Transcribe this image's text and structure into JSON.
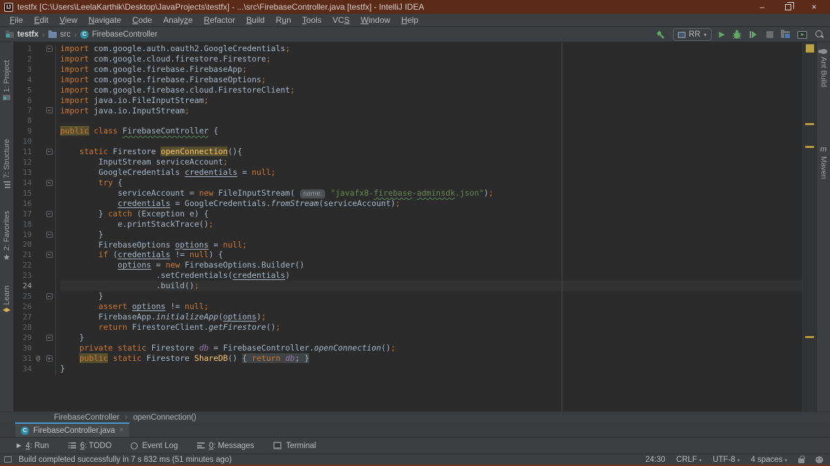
{
  "window": {
    "title": "testfx [C:\\Users\\LeelaKarthik\\Desktop\\JavaProjects\\testfx] - ...\\src\\FirebaseController.java [testfx] - IntelliJ IDEA",
    "minimize": "–",
    "close": "×"
  },
  "menu": {
    "items": [
      {
        "label": "File",
        "u": 0
      },
      {
        "label": "Edit",
        "u": 0
      },
      {
        "label": "View",
        "u": 0
      },
      {
        "label": "Navigate",
        "u": 0
      },
      {
        "label": "Code",
        "u": 0
      },
      {
        "label": "Analyze",
        "u": 5
      },
      {
        "label": "Refactor",
        "u": 0
      },
      {
        "label": "Build",
        "u": 0
      },
      {
        "label": "Run",
        "u": 1
      },
      {
        "label": "Tools",
        "u": 0
      },
      {
        "label": "VCS",
        "u": 2
      },
      {
        "label": "Window",
        "u": 0
      },
      {
        "label": "Help",
        "u": 0
      }
    ]
  },
  "navbar": {
    "crumbs": [
      {
        "label": "testfx",
        "icon": "project-folder-icon",
        "bold": true
      },
      {
        "label": "src",
        "icon": "folder-icon"
      },
      {
        "label": "FirebaseController",
        "icon": "class-icon"
      }
    ],
    "run_config": "RR",
    "dropdown_arrow": "▾"
  },
  "left_stripe": {
    "items": [
      {
        "label": "1: Project"
      },
      {
        "label": "7: Structure"
      },
      {
        "label": "2: Favorites"
      },
      {
        "label": "Learn"
      }
    ]
  },
  "right_stripe": {
    "items": [
      {
        "label": "Ant Build"
      },
      {
        "label": "Maven"
      }
    ]
  },
  "editor": {
    "current_line": 24,
    "stripe_marks": [
      117,
      150,
      425
    ],
    "lines": [
      {
        "n": 1,
        "fold": "m",
        "seg": [
          {
            "t": "import",
            "s": "kw"
          },
          {
            "t": " com.google.auth.oauth2.GoogleCredentials",
            "s": "tx"
          },
          {
            "t": ";",
            "s": "kw"
          }
        ]
      },
      {
        "n": 2,
        "seg": [
          {
            "t": "import",
            "s": "kw"
          },
          {
            "t": " com.google.cloud.firestore.Firestore",
            "s": "tx"
          },
          {
            "t": ";",
            "s": "kw"
          }
        ]
      },
      {
        "n": 3,
        "seg": [
          {
            "t": "import",
            "s": "kw"
          },
          {
            "t": " com.google.firebase.FirebaseApp",
            "s": "tx"
          },
          {
            "t": ";",
            "s": "kw"
          }
        ]
      },
      {
        "n": 4,
        "seg": [
          {
            "t": "import",
            "s": "kw"
          },
          {
            "t": " com.google.firebase.FirebaseOptions",
            "s": "tx"
          },
          {
            "t": ";",
            "s": "kw"
          }
        ]
      },
      {
        "n": 5,
        "seg": [
          {
            "t": "import",
            "s": "kw"
          },
          {
            "t": " com.google.firebase.cloud.FirestoreClient",
            "s": "tx"
          },
          {
            "t": ";",
            "s": "kw"
          }
        ]
      },
      {
        "n": 6,
        "seg": [
          {
            "t": "import",
            "s": "kw"
          },
          {
            "t": " java.io.FileInputStream",
            "s": "tx"
          },
          {
            "t": ";",
            "s": "kw"
          }
        ]
      },
      {
        "n": 7,
        "fold": "m",
        "seg": [
          {
            "t": "import",
            "s": "kw"
          },
          {
            "t": " java.io.InputStream",
            "s": "tx"
          },
          {
            "t": ";",
            "s": "kw"
          }
        ]
      },
      {
        "n": 8,
        "seg": []
      },
      {
        "n": 9,
        "seg": [
          {
            "t": "public",
            "s": "kw hl"
          },
          {
            "t": " ",
            "s": "tx"
          },
          {
            "t": "class",
            "s": "kw"
          },
          {
            "t": " ",
            "s": "tx"
          },
          {
            "t": "FirebaseController",
            "s": "tx wv"
          },
          {
            "t": " {",
            "s": "tx"
          }
        ]
      },
      {
        "n": 10,
        "seg": []
      },
      {
        "n": 11,
        "fold": "m",
        "seg": [
          {
            "t": "    ",
            "s": "tx"
          },
          {
            "t": "static",
            "s": "kw"
          },
          {
            "t": " Firestore ",
            "s": "tx"
          },
          {
            "t": "openConnection",
            "s": "md hl"
          },
          {
            "t": "(){",
            "s": "tx"
          }
        ]
      },
      {
        "n": 12,
        "seg": [
          {
            "t": "        InputStream serviceAccount",
            "s": "tx"
          },
          {
            "t": ";",
            "s": "kw"
          }
        ]
      },
      {
        "n": 13,
        "seg": [
          {
            "t": "        GoogleCredentials ",
            "s": "tx"
          },
          {
            "t": "credentials",
            "s": "tx ul"
          },
          {
            "t": " = ",
            "s": "tx"
          },
          {
            "t": "null",
            "s": "kw"
          },
          {
            "t": ";",
            "s": "kw"
          }
        ]
      },
      {
        "n": 14,
        "fold": "m",
        "seg": [
          {
            "t": "        ",
            "s": "tx"
          },
          {
            "t": "try",
            "s": "kw"
          },
          {
            "t": " {",
            "s": "tx"
          }
        ]
      },
      {
        "n": 15,
        "seg": [
          {
            "t": "            serviceAccount = ",
            "s": "tx"
          },
          {
            "t": "new",
            "s": "kw"
          },
          {
            "t": " FileInputStream( ",
            "s": "tx"
          },
          {
            "t": "name:",
            "s": "hn"
          },
          {
            "t": " ",
            "s": "tx"
          },
          {
            "t": "\"javafx8-",
            "s": "st"
          },
          {
            "t": "firebase",
            "s": "st wv"
          },
          {
            "t": "-",
            "s": "st"
          },
          {
            "t": "adminsdk",
            "s": "st wv"
          },
          {
            "t": ".json\"",
            "s": "st"
          },
          {
            "t": ")",
            "s": "tx"
          },
          {
            "t": ";",
            "s": "kw"
          }
        ]
      },
      {
        "n": 16,
        "seg": [
          {
            "t": "            ",
            "s": "tx"
          },
          {
            "t": "credentials",
            "s": "tx ul"
          },
          {
            "t": " = GoogleCredentials.",
            "s": "tx"
          },
          {
            "t": "fromStream",
            "s": "tx it"
          },
          {
            "t": "(serviceAccount)",
            "s": "tx"
          },
          {
            "t": ";",
            "s": "kw"
          }
        ]
      },
      {
        "n": 17,
        "fold": "m",
        "seg": [
          {
            "t": "        } ",
            "s": "tx"
          },
          {
            "t": "catch",
            "s": "kw"
          },
          {
            "t": " (Exception e) {",
            "s": "tx"
          }
        ]
      },
      {
        "n": 18,
        "seg": [
          {
            "t": "            e.printStackTrace()",
            "s": "tx"
          },
          {
            "t": ";",
            "s": "kw"
          }
        ]
      },
      {
        "n": 19,
        "fold": "m",
        "seg": [
          {
            "t": "        }",
            "s": "tx"
          }
        ]
      },
      {
        "n": 20,
        "seg": [
          {
            "t": "        FirebaseOptions ",
            "s": "tx"
          },
          {
            "t": "options",
            "s": "tx ul"
          },
          {
            "t": " = ",
            "s": "tx"
          },
          {
            "t": "null",
            "s": "kw"
          },
          {
            "t": ";",
            "s": "kw"
          }
        ]
      },
      {
        "n": 21,
        "fold": "m",
        "seg": [
          {
            "t": "        ",
            "s": "tx"
          },
          {
            "t": "if",
            "s": "kw"
          },
          {
            "t": " (",
            "s": "tx"
          },
          {
            "t": "credentials",
            "s": "tx ul"
          },
          {
            "t": " != ",
            "s": "tx"
          },
          {
            "t": "null",
            "s": "kw"
          },
          {
            "t": ") {",
            "s": "tx"
          }
        ]
      },
      {
        "n": 22,
        "seg": [
          {
            "t": "            ",
            "s": "tx"
          },
          {
            "t": "options",
            "s": "tx ul"
          },
          {
            "t": " = ",
            "s": "tx"
          },
          {
            "t": "new",
            "s": "kw"
          },
          {
            "t": " FirebaseOptions.Builder()",
            "s": "tx"
          }
        ]
      },
      {
        "n": 23,
        "seg": [
          {
            "t": "                    .setCredentials(",
            "s": "tx"
          },
          {
            "t": "credentials",
            "s": "tx ul"
          },
          {
            "t": ")",
            "s": "tx"
          }
        ]
      },
      {
        "n": 24,
        "seg": [
          {
            "t": "                    .build()",
            "s": "tx"
          },
          {
            "t": ";",
            "s": "kw"
          }
        ]
      },
      {
        "n": 25,
        "fold": "m",
        "seg": [
          {
            "t": "        }",
            "s": "tx"
          }
        ]
      },
      {
        "n": 26,
        "seg": [
          {
            "t": "        ",
            "s": "tx"
          },
          {
            "t": "assert",
            "s": "kw"
          },
          {
            "t": " ",
            "s": "tx"
          },
          {
            "t": "options",
            "s": "tx ul"
          },
          {
            "t": " != ",
            "s": "tx"
          },
          {
            "t": "null",
            "s": "kw"
          },
          {
            "t": ";",
            "s": "kw"
          }
        ]
      },
      {
        "n": 27,
        "seg": [
          {
            "t": "        FirebaseApp.",
            "s": "tx"
          },
          {
            "t": "initializeApp",
            "s": "tx it"
          },
          {
            "t": "(",
            "s": "tx"
          },
          {
            "t": "options",
            "s": "tx ul"
          },
          {
            "t": ")",
            "s": "tx"
          },
          {
            "t": ";",
            "s": "kw"
          }
        ]
      },
      {
        "n": 28,
        "seg": [
          {
            "t": "        ",
            "s": "tx"
          },
          {
            "t": "return",
            "s": "kw"
          },
          {
            "t": " FirestoreClient.",
            "s": "tx"
          },
          {
            "t": "getFirestore",
            "s": "tx it"
          },
          {
            "t": "()",
            "s": "tx"
          },
          {
            "t": ";",
            "s": "kw"
          }
        ]
      },
      {
        "n": 29,
        "fold": "m",
        "seg": [
          {
            "t": "    }",
            "s": "tx"
          }
        ]
      },
      {
        "n": 30,
        "seg": [
          {
            "t": "    ",
            "s": "tx"
          },
          {
            "t": "private",
            "s": "kw"
          },
          {
            "t": " ",
            "s": "tx"
          },
          {
            "t": "static",
            "s": "kw"
          },
          {
            "t": " Firestore ",
            "s": "tx"
          },
          {
            "t": "db",
            "s": "fd it"
          },
          {
            "t": " = FirebaseController.",
            "s": "tx"
          },
          {
            "t": "openConnection",
            "s": "tx it"
          },
          {
            "t": "()",
            "s": "tx"
          },
          {
            "t": ";",
            "s": "kw"
          }
        ]
      },
      {
        "n": 31,
        "fold": "p",
        "ann": "@",
        "seg": [
          {
            "t": "    ",
            "s": "tx"
          },
          {
            "t": "public",
            "s": "kw hl"
          },
          {
            "t": " ",
            "s": "tx"
          },
          {
            "t": "static",
            "s": "kw"
          },
          {
            "t": " Firestore ",
            "s": "tx"
          },
          {
            "t": "ShareDB",
            "s": "md"
          },
          {
            "t": "() ",
            "s": "tx"
          },
          {
            "t": "{ ",
            "s": "tx fb"
          },
          {
            "t": "return",
            "s": "kw fb"
          },
          {
            "t": " ",
            "s": "tx fb"
          },
          {
            "t": "db",
            "s": "fd it fb"
          },
          {
            "t": "; }",
            "s": "tx fb"
          }
        ]
      },
      {
        "n": 34,
        "seg": [
          {
            "t": "}",
            "s": "tx"
          }
        ]
      }
    ]
  },
  "breadcrumb_bar": {
    "class": "FirebaseController",
    "separator": "›",
    "method": "openConnection()"
  },
  "tab_bar": {
    "active_tab": "FirebaseController.java",
    "close": "×"
  },
  "bottom_bar": {
    "items": [
      {
        "label": "4: Run",
        "u": 0
      },
      {
        "label": "6: TODO",
        "u": 0
      },
      {
        "label": "Event Log"
      },
      {
        "label": "0: Messages",
        "u": 0
      },
      {
        "label": "Terminal"
      }
    ]
  },
  "status_bar": {
    "message": "Build completed successfully in 7 s 832 ms (51 minutes ago)",
    "caret_position": "24:30",
    "line_separator": "CRLF",
    "encoding": "UTF-8",
    "indent": "4 spaces",
    "dropdown_arrow": "▾"
  },
  "colors": {
    "titlebar": "#5C2A18",
    "chrome_bg": "#3C3F41",
    "editor_bg": "#2B2B2B",
    "keyword": "#CC7832",
    "string": "#6A8759",
    "identifier_highlight": "#56502E",
    "tab_underline": "#4A9BD5",
    "warning_stripe": "#BBA23C"
  }
}
